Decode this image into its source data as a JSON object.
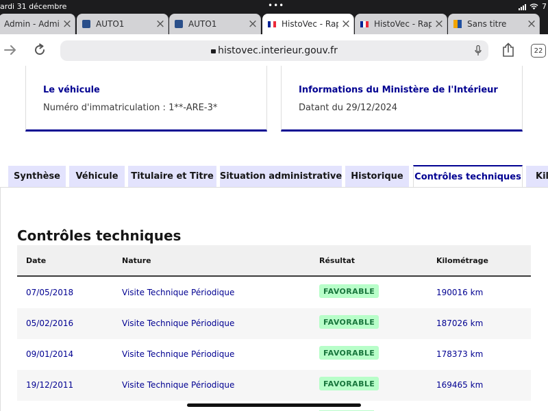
{
  "status": {
    "date": "ardi 31 décembre",
    "battery_fragment": "7"
  },
  "browser_tabs": [
    {
      "title": "Admin - Admin",
      "favicon": "none",
      "active": false
    },
    {
      "title": "AUTO1",
      "favicon": "auto1-icon",
      "active": false
    },
    {
      "title": "AUTO1",
      "favicon": "auto1-icon",
      "active": false
    },
    {
      "title": "HistoVec - Rapport",
      "favicon": "flag-icon",
      "active": true
    },
    {
      "title": "HistoVec - Rapport",
      "favicon": "flag-icon",
      "active": false
    },
    {
      "title": "Sans titre",
      "favicon": "doc-icon",
      "active": false
    }
  ],
  "toolbar": {
    "url": "histovec.interieur.gouv.fr",
    "tab_count": "22"
  },
  "cards": {
    "vehicle": {
      "title": "Le véhicule",
      "text": "Numéro d'immatriculation : 1**-ARE-3*"
    },
    "ministry": {
      "title": "Informations du Ministère de l'Intérieur",
      "text": "Datant du 29/12/2024"
    }
  },
  "page_tabs": [
    "Synthèse",
    "Véhicule",
    "Titulaire et Titre",
    "Situation administrative",
    "Historique",
    "Contrôles techniques",
    "Kilométrage"
  ],
  "section": {
    "title": "Contrôles techniques",
    "columns": {
      "date": "Date",
      "nature": "Nature",
      "result": "Résultat",
      "km": "Kilométrage"
    },
    "rows": [
      {
        "date": "07/05/2018",
        "nature": "Visite Technique Périodique",
        "result": "FAVORABLE",
        "km": "190016 km"
      },
      {
        "date": "05/02/2016",
        "nature": "Visite Technique Périodique",
        "result": "FAVORABLE",
        "km": "187026 km"
      },
      {
        "date": "09/01/2014",
        "nature": "Visite Technique Périodique",
        "result": "FAVORABLE",
        "km": "178373 km"
      },
      {
        "date": "19/12/2011",
        "nature": "Visite Technique Périodique",
        "result": "FAVORABLE",
        "km": "169465 km"
      }
    ]
  },
  "colors": {
    "primary": "#000091",
    "tab_bg": "#e3e3fd",
    "badge_bg": "#b8fec9",
    "badge_text": "#18753c"
  }
}
